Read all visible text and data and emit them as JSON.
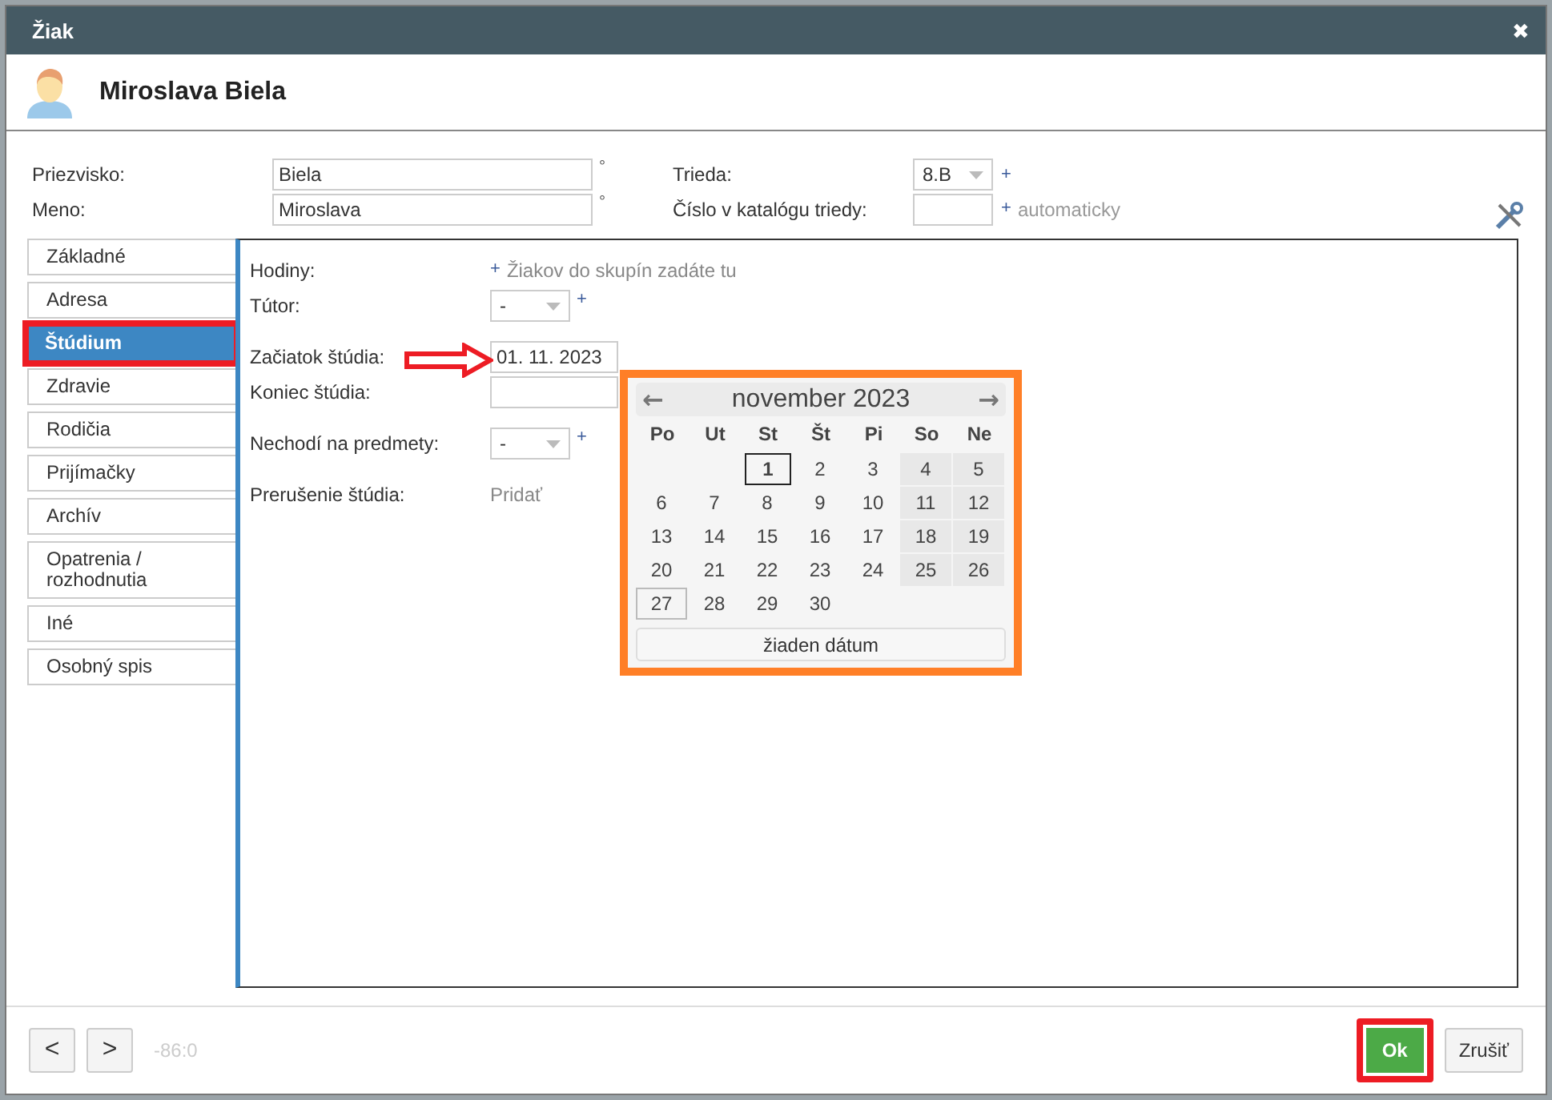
{
  "window": {
    "title": "Žiak",
    "close": "✖"
  },
  "header": {
    "name": "Miroslava Biela"
  },
  "form": {
    "left": [
      {
        "label": "Priezvisko:",
        "value": "Biela",
        "mark": "°"
      },
      {
        "label": "Meno:",
        "value": "Miroslava",
        "mark": "°"
      }
    ],
    "right": [
      {
        "kind": "select",
        "label": "Trieda:",
        "value": "8.B",
        "mark": "+"
      },
      {
        "kind": "input",
        "label": "Číslo v katalógu triedy:",
        "mark": "+",
        "hint": "automaticky"
      }
    ]
  },
  "tabs": [
    {
      "label": "Základné",
      "selected": false,
      "highlighted": false
    },
    {
      "label": "Adresa",
      "selected": false,
      "highlighted": false
    },
    {
      "label": "Štúdium",
      "selected": true,
      "highlighted": true
    },
    {
      "label": "Zdravie",
      "selected": false,
      "highlighted": false
    },
    {
      "label": "Rodičia",
      "selected": false,
      "highlighted": false
    },
    {
      "label": "Prijímačky",
      "selected": false,
      "highlighted": false
    },
    {
      "label": "Archív",
      "selected": false,
      "highlighted": false
    },
    {
      "label": "Opatrenia / rozhodnutia",
      "selected": false,
      "highlighted": false
    },
    {
      "label": "Iné",
      "selected": false,
      "highlighted": false
    },
    {
      "label": "Osobný spis",
      "selected": false,
      "highlighted": false
    }
  ],
  "study": [
    {
      "kind": "link",
      "label": "Hodiny:",
      "mark": "+",
      "text": "Žiakov do skupín zadáte tu"
    },
    {
      "kind": "select",
      "label": "Tútor:",
      "value": "-",
      "mark": "+"
    },
    {
      "kind": "date",
      "label": "Začiatok štúdia:",
      "value": "01. 11. 2023",
      "pointed_at": true
    },
    {
      "kind": "date",
      "label": "Koniec štúdia:",
      "pointed_at": false
    },
    {
      "kind": "select",
      "label": "Nechodí na predmety:",
      "value": "-",
      "mark": "+"
    },
    {
      "kind": "link",
      "label": "Prerušenie štúdia:",
      "text": "Pridať"
    }
  ],
  "date_picker": {
    "highlighted": true,
    "prev": "←",
    "next": "→",
    "month": "november 2023",
    "weekdays": [
      "Po",
      "Ut",
      "St",
      "Št",
      "Pi",
      "So",
      "Ne"
    ],
    "weeks": [
      [
        {
          "kind": "blank"
        },
        {
          "kind": "blank"
        },
        {
          "kind": "day",
          "day": "1",
          "selected": true,
          "today": false
        },
        {
          "kind": "day",
          "day": "2",
          "selected": false,
          "today": false
        },
        {
          "kind": "day",
          "day": "3",
          "selected": false,
          "today": false
        },
        {
          "kind": "day",
          "day": "4",
          "selected": false,
          "today": false
        },
        {
          "kind": "day",
          "day": "5",
          "selected": false,
          "today": false
        }
      ],
      [
        {
          "kind": "day",
          "day": "6",
          "selected": false,
          "today": false
        },
        {
          "kind": "day",
          "day": "7",
          "selected": false,
          "today": false
        },
        {
          "kind": "day",
          "day": "8",
          "selected": false,
          "today": false
        },
        {
          "kind": "day",
          "day": "9",
          "selected": false,
          "today": false
        },
        {
          "kind": "day",
          "day": "10",
          "selected": false,
          "today": false
        },
        {
          "kind": "day",
          "day": "11",
          "selected": false,
          "today": false
        },
        {
          "kind": "day",
          "day": "12",
          "selected": false,
          "today": false
        }
      ],
      [
        {
          "kind": "day",
          "day": "13",
          "selected": false,
          "today": false
        },
        {
          "kind": "day",
          "day": "14",
          "selected": false,
          "today": false
        },
        {
          "kind": "day",
          "day": "15",
          "selected": false,
          "today": false
        },
        {
          "kind": "day",
          "day": "16",
          "selected": false,
          "today": false
        },
        {
          "kind": "day",
          "day": "17",
          "selected": false,
          "today": false
        },
        {
          "kind": "day",
          "day": "18",
          "selected": false,
          "today": false
        },
        {
          "kind": "day",
          "day": "19",
          "selected": false,
          "today": false
        }
      ],
      [
        {
          "kind": "day",
          "day": "20",
          "selected": false,
          "today": false
        },
        {
          "kind": "day",
          "day": "21",
          "selected": false,
          "today": false
        },
        {
          "kind": "day",
          "day": "22",
          "selected": false,
          "today": false
        },
        {
          "kind": "day",
          "day": "23",
          "selected": false,
          "today": false
        },
        {
          "kind": "day",
          "day": "24",
          "selected": false,
          "today": false
        },
        {
          "kind": "day",
          "day": "25",
          "selected": false,
          "today": false
        },
        {
          "kind": "day",
          "day": "26",
          "selected": false,
          "today": false
        }
      ],
      [
        {
          "kind": "day",
          "day": "27",
          "selected": false,
          "today": true
        },
        {
          "kind": "day",
          "day": "28",
          "selected": false,
          "today": false
        },
        {
          "kind": "day",
          "day": "29",
          "selected": false,
          "today": false
        },
        {
          "kind": "day",
          "day": "30",
          "selected": false,
          "today": false
        },
        {
          "kind": "blank"
        },
        {
          "kind": "blank"
        },
        {
          "kind": "blank"
        }
      ]
    ],
    "clear": "žiaden dátum"
  },
  "footer": {
    "prev": "<",
    "next": ">",
    "counter": "-86:0",
    "buttons": [
      {
        "kind": "primary",
        "label": "Ok",
        "highlighted": true
      },
      {
        "kind": "secondary",
        "label": "Zrušiť",
        "highlighted": false
      }
    ]
  }
}
